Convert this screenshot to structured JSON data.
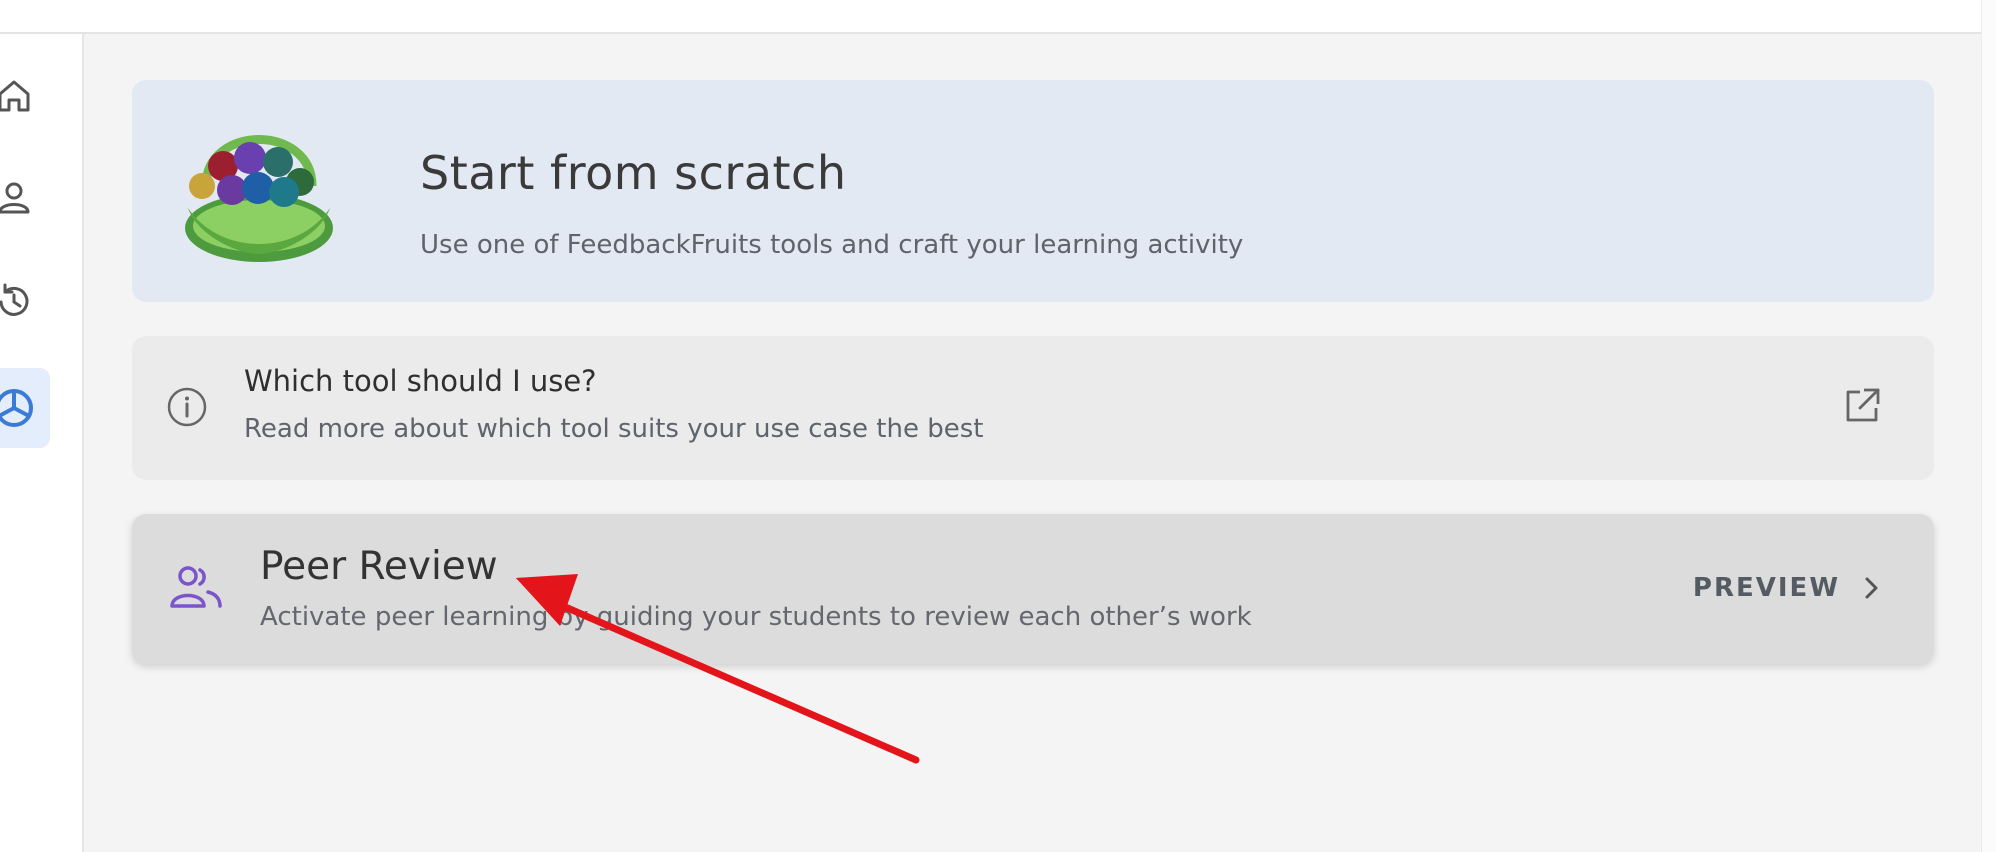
{
  "sidebar": {
    "items": [
      {
        "icon": "home-icon"
      },
      {
        "icon": "user-icon"
      },
      {
        "icon": "history-icon"
      },
      {
        "icon": "fruit-slice-icon",
        "active": true
      }
    ]
  },
  "scratch": {
    "title": "Start from scratch",
    "subtitle": "Use one of FeedbackFruits tools and craft your learning activity"
  },
  "info": {
    "title": "Which tool should I use?",
    "subtitle": "Read more about which tool suits your use case the best"
  },
  "peer_review": {
    "title": "Peer Review",
    "subtitle": "Activate peer learning by guiding your students to review each other’s work",
    "preview_label": "PREVIEW"
  },
  "colors": {
    "accent_blue": "#3a7bd5",
    "peer_purple": "#7b54c9",
    "annotation_red": "#e4141b"
  }
}
